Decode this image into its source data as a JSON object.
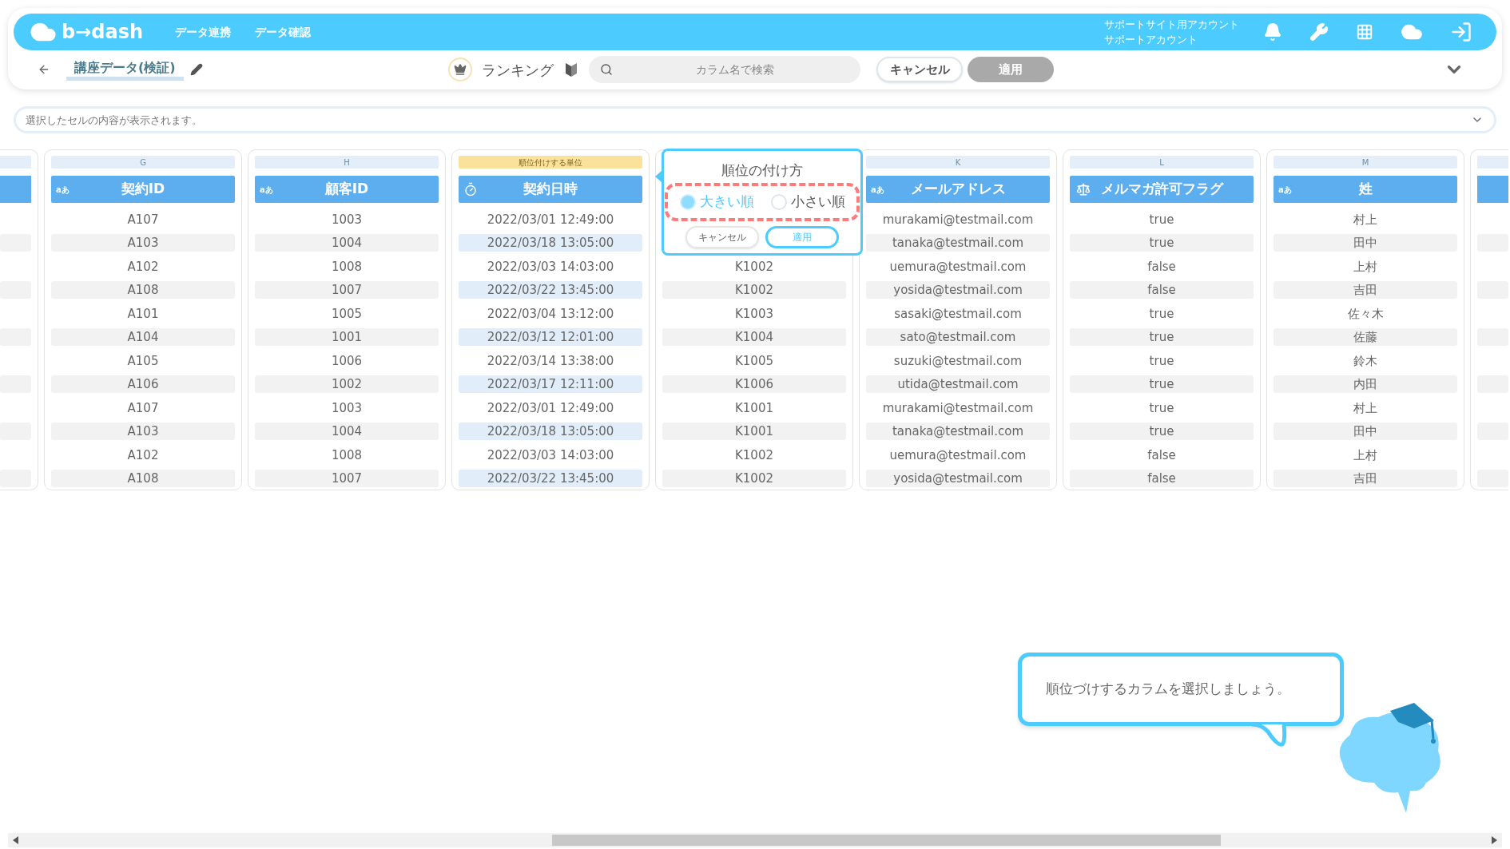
{
  "navbar": {
    "logo": "b→dash",
    "menu": [
      "データ連携",
      "データ確認"
    ],
    "account": [
      "サポートサイト用アカウント",
      "サポートアカウント"
    ]
  },
  "toolbar": {
    "title": "講座データ(検証)",
    "mode": "ランキング",
    "search": {
      "placeholder": "カラム名で検索"
    },
    "buttons": [
      {
        "label": "キャンセル",
        "disabled": false
      },
      {
        "label": "適用",
        "disabled": true
      }
    ]
  },
  "cell_bar": {
    "placeholder": "選択したセルの内容が表示されます。"
  },
  "columns": [
    {
      "top": "G",
      "ranking_unit": false,
      "kind": "text",
      "icon_text": "aあ",
      "label": "契約ID",
      "cells": [
        "A107",
        "A103",
        "A102",
        "A108",
        "A101",
        "A104",
        "A105",
        "A106",
        "A107",
        "A103",
        "A102",
        "A108"
      ]
    },
    {
      "top": "H",
      "ranking_unit": false,
      "kind": "text",
      "icon_text": "aあ",
      "label": "顧客ID",
      "cells": [
        "1003",
        "1004",
        "1008",
        "1007",
        "1005",
        "1001",
        "1006",
        "1002",
        "1003",
        "1004",
        "1008",
        "1007"
      ]
    },
    {
      "top": "順位付けする単位",
      "ranking_unit": true,
      "kind": "datetime",
      "label": "契約日時",
      "cells": [
        "2022/03/01 12:49:00",
        "2022/03/18 13:05:00",
        "2022/03/03 14:03:00",
        "2022/03/22 13:45:00",
        "2022/03/04 13:12:00",
        "2022/03/12 12:01:00",
        "2022/03/14 13:38:00",
        "2022/03/17 12:11:00",
        "2022/03/01 12:49:00",
        "2022/03/18 13:05:00",
        "2022/03/03 14:03:00",
        "2022/03/22 13:45:00"
      ]
    },
    {
      "ranking_unit": false,
      "kind": "covered",
      "cells": [
        "K1002",
        "K1002",
        "K1003",
        "K1004",
        "K1005",
        "K1006",
        "K1001",
        "K1001",
        "K1002",
        "K1002"
      ]
    },
    {
      "top": "K",
      "ranking_unit": false,
      "kind": "text",
      "icon_text": "aあ",
      "label": "メールアドレス",
      "cells": [
        "murakami@testmail.com",
        "tanaka@testmail.com",
        "uemura@testmail.com",
        "yosida@testmail.com",
        "sasaki@testmail.com",
        "sato@testmail.com",
        "suzuki@testmail.com",
        "utida@testmail.com",
        "murakami@testmail.com",
        "tanaka@testmail.com",
        "uemura@testmail.com",
        "yosida@testmail.com"
      ]
    },
    {
      "top": "L",
      "ranking_unit": false,
      "kind": "boolean",
      "label": "メルマガ許可フラグ",
      "cells": [
        "true",
        "true",
        "false",
        "false",
        "true",
        "true",
        "true",
        "true",
        "true",
        "true",
        "false",
        "false"
      ]
    },
    {
      "top": "M",
      "ranking_unit": false,
      "kind": "text",
      "icon_text": "aあ",
      "label": "姓",
      "cells": [
        "村上",
        "田中",
        "上村",
        "吉田",
        "佐々木",
        "佐藤",
        "鈴木",
        "内田",
        "村上",
        "田中",
        "上村",
        "吉田"
      ]
    }
  ],
  "popup": {
    "title": "順位の付け方",
    "options": [
      {
        "label": "大きい順",
        "selected": true
      },
      {
        "label": "小さい順",
        "selected": false
      }
    ],
    "buttons": [
      {
        "label": "キャンセル",
        "primary": false
      },
      {
        "label": "適用",
        "primary": true
      }
    ]
  },
  "tooltip": {
    "text": "順位づけするカラムを選択しましょう。"
  }
}
